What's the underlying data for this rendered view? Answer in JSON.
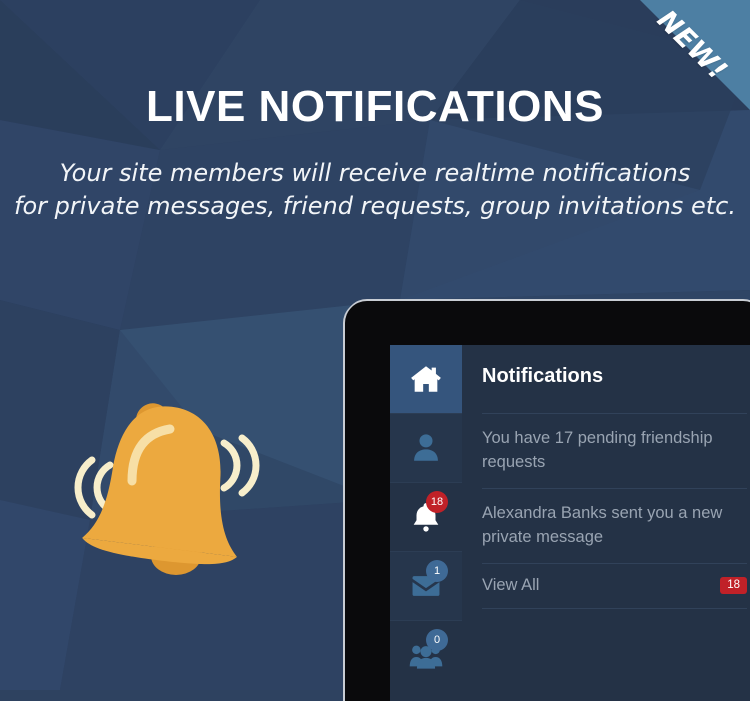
{
  "ribbon": {
    "label": "NEW!",
    "color": "#4d7fa3"
  },
  "hero": {
    "headline": "LIVE NOTIFICATIONS",
    "subhead_line1": "Your site members will receive realtime notifications",
    "subhead_line2": "for private messages, friend requests, group invitations etc."
  },
  "illustration": {
    "name": "ringing-bell",
    "bell_color": "#eca93f",
    "bell_shadow_color": "#dd9730",
    "wave_color": "#f7eecb"
  },
  "theme": {
    "background": "#2e4260",
    "panel_bg": "#243246",
    "panel_active": "#35557d",
    "badge_red": "#c02128",
    "badge_blue": "#3f6a96",
    "icon_muted": "#3d6d96",
    "icon_active": "#ffffff",
    "body_text": "#99a4b2",
    "divider": "#31425a"
  },
  "panel": {
    "title": "Notifications",
    "rail": [
      {
        "name": "home",
        "icon": "home-icon",
        "badge": null,
        "state": "active"
      },
      {
        "name": "friends",
        "icon": "person-icon",
        "badge": null,
        "state": "tint"
      },
      {
        "name": "notifications",
        "icon": "bell-icon",
        "badge": "18",
        "badge_color": "red",
        "state": "default"
      },
      {
        "name": "messages",
        "icon": "envelope-icon",
        "badge": "1",
        "badge_color": "blue",
        "state": "tint"
      },
      {
        "name": "groups",
        "icon": "group-icon",
        "badge": "0",
        "badge_color": "blue",
        "state": "default"
      }
    ],
    "notifications": [
      {
        "text": "You have 17 pending friendship requests"
      },
      {
        "text": "Alexandra Banks sent you a new private message"
      }
    ],
    "view_all": {
      "label": "View All",
      "count": "18"
    }
  }
}
